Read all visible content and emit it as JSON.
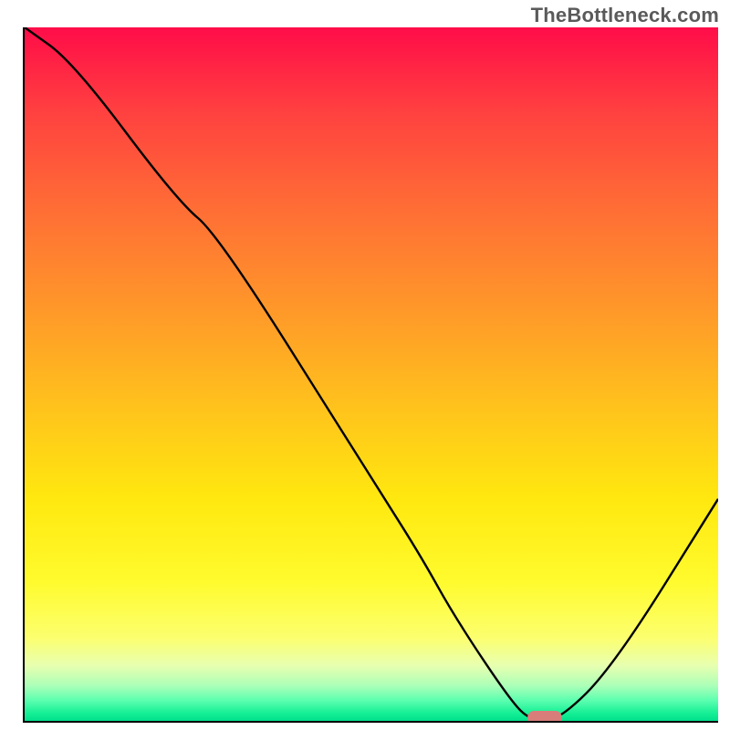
{
  "watermark": "TheBottleneck.com",
  "colors": {
    "curve": "#000000",
    "marker": "#d87d7a",
    "axis": "#000000"
  },
  "chart_data": {
    "type": "line",
    "title": "",
    "xlabel": "",
    "ylabel": "",
    "ylim": [
      0,
      100
    ],
    "xlim": [
      0,
      100
    ],
    "curve": {
      "x": [
        0,
        7,
        22,
        28,
        50,
        57,
        62,
        70,
        73,
        77,
        85,
        100
      ],
      "y_pct": [
        100,
        95,
        75,
        70,
        35,
        24,
        15,
        3,
        0,
        0,
        8,
        32
      ]
    },
    "marker": {
      "x": 75,
      "y_pct": 0.5
    }
  }
}
